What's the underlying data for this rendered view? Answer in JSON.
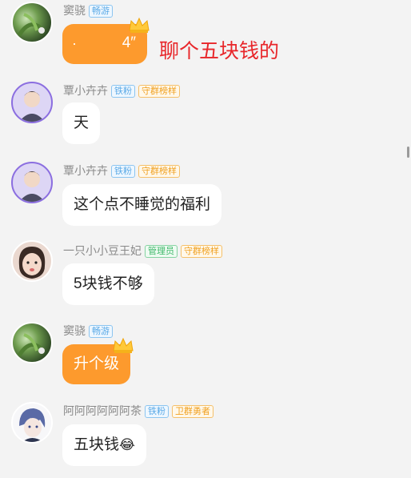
{
  "messages": [
    {
      "sender": "窦骁",
      "badges": [
        {
          "text": "畅游",
          "style": "blue"
        }
      ],
      "type": "voice",
      "voice_duration": "4″",
      "annotation": "聊个五块钱的",
      "bubble_color": "#fd9a2d"
    },
    {
      "sender": "覃小卉卉",
      "badges": [
        {
          "text": "铁粉",
          "style": "blue"
        },
        {
          "text": "守群榜样",
          "style": "orange"
        }
      ],
      "type": "text",
      "text": "天"
    },
    {
      "sender": "覃小卉卉",
      "badges": [
        {
          "text": "铁粉",
          "style": "blue"
        },
        {
          "text": "守群榜样",
          "style": "orange"
        }
      ],
      "type": "text",
      "text": "这个点不睡觉的福利"
    },
    {
      "sender": "一只小小豆王妃",
      "badges": [
        {
          "text": "管理员",
          "style": "green"
        },
        {
          "text": "守群榜样",
          "style": "orange"
        }
      ],
      "type": "text",
      "text": "5块钱不够"
    },
    {
      "sender": "窦骁",
      "badges": [
        {
          "text": "畅游",
          "style": "blue"
        }
      ],
      "type": "text",
      "text": "升个级",
      "bubble_color": "#fd9a2d"
    },
    {
      "sender": "阿阿阿阿阿阿茶",
      "badges": [
        {
          "text": "铁粉",
          "style": "blue"
        },
        {
          "text": "卫群勇者",
          "style": "orange"
        }
      ],
      "type": "text",
      "text": "五块钱",
      "emoji": "😂"
    }
  ],
  "colors": {
    "accent_orange": "#fd9a2d",
    "annotation_red": "#e8262a",
    "background": "#f3f3f3"
  }
}
